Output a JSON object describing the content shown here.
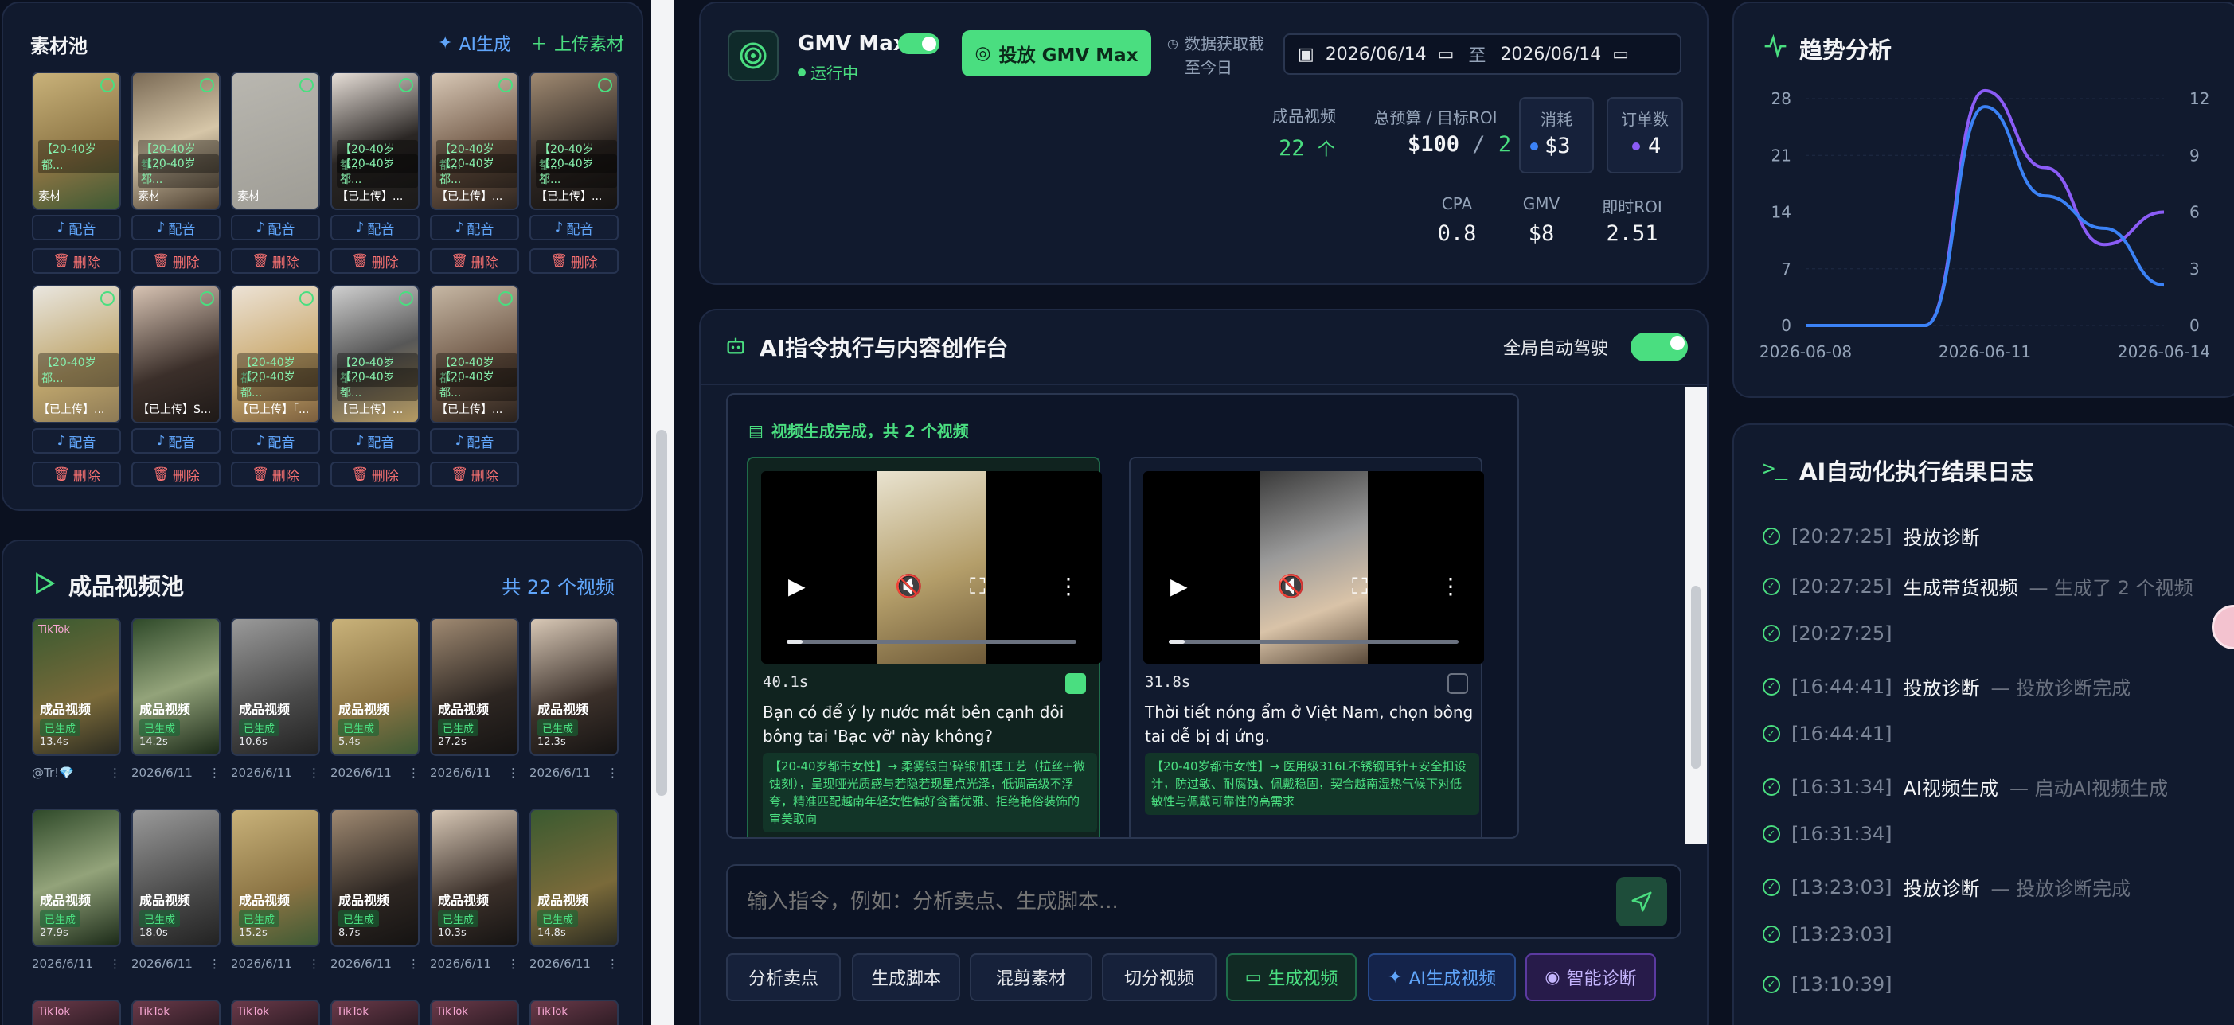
{
  "material_pool": {
    "title": "素材池",
    "ai_generate": "AI生成",
    "upload": "上传素材",
    "dub_label": "配音",
    "delete_label": "删除",
    "items": [
      {
        "tag1": "【20-40岁都...",
        "tag2": "",
        "caption": "素材"
      },
      {
        "tag1": "【20-40岁都...",
        "tag2": "【20-40岁都...",
        "caption": "素材"
      },
      {
        "tag1": "",
        "tag2": "",
        "caption": "素材"
      },
      {
        "tag1": "【20-40岁都...",
        "tag2": "【20-40岁都...",
        "caption": "【已上传】..."
      },
      {
        "tag1": "【20-40岁都...",
        "tag2": "【20-40岁都...",
        "caption": "【已上传】..."
      },
      {
        "tag1": "【20-40岁都...",
        "tag2": "【20-40岁都...",
        "caption": "【已上传】..."
      },
      {
        "tag1": "【20-40岁都...",
        "tag2": "",
        "caption": "【已上传】..."
      },
      {
        "tag1": "",
        "tag2": "",
        "caption": "【已上传】S..."
      },
      {
        "tag1": "【20-40岁都...",
        "tag2": "【20-40岁都...",
        "caption": "【已上传】「..."
      },
      {
        "tag1": "【20-40岁都...",
        "tag2": "【20-40岁都...",
        "caption": "【已上传】..."
      },
      {
        "tag1": "【20-40岁都...",
        "tag2": "【20-40岁都...",
        "caption": "【已上传】..."
      }
    ]
  },
  "video_pool": {
    "title": "成品视频池",
    "count": "共 22 个视频",
    "card_label": "成品视频",
    "generated": "已生成",
    "tiktok": "TikTok",
    "rows": [
      [
        {
          "dur": "13.4s",
          "meta": "@Tr!💎",
          "tiktok": true
        },
        {
          "dur": "14.2s",
          "meta": "2026/6/11",
          "tiktok": false
        },
        {
          "dur": "10.6s",
          "meta": "2026/6/11",
          "tiktok": false
        },
        {
          "dur": "5.4s",
          "meta": "2026/6/11",
          "tiktok": false
        },
        {
          "dur": "27.2s",
          "meta": "2026/6/11",
          "tiktok": false
        },
        {
          "dur": "12.3s",
          "meta": "2026/6/11",
          "tiktok": false
        }
      ],
      [
        {
          "dur": "27.9s",
          "meta": "2026/6/11",
          "tiktok": false
        },
        {
          "dur": "18.0s",
          "meta": "2026/6/11",
          "tiktok": false
        },
        {
          "dur": "15.2s",
          "meta": "2026/6/11",
          "tiktok": false
        },
        {
          "dur": "8.7s",
          "meta": "2026/6/11",
          "tiktok": false
        },
        {
          "dur": "10.3s",
          "meta": "2026/6/11",
          "tiktok": false
        },
        {
          "dur": "14.8s",
          "meta": "2026/6/11",
          "tiktok": false
        }
      ]
    ]
  },
  "gmv": {
    "name": "GMV Max",
    "status": "运行中",
    "launch_button": "投放 GMV Max",
    "fetch_label_1": "数据获取截",
    "fetch_label_2": "至今日",
    "date_from": "2026/06/14",
    "date_sep": "至",
    "date_to": "2026/06/14",
    "finished_videos_label": "成品视频",
    "finished_videos_value": "22",
    "finished_videos_unit": "个",
    "budget_label": "总预算 / 目标ROI",
    "budget_value": "$100",
    "budget_sep": "/",
    "roi_target": "2",
    "spend_label": "消耗",
    "spend_value": "$3",
    "orders_label": "订单数",
    "orders_value": "4",
    "cpa_label": "CPA",
    "cpa_value": "0.8",
    "gmv_label": "GMV",
    "gmv_value": "$8",
    "roi_label": "即时ROI",
    "roi_value": "2.51"
  },
  "ai_workspace": {
    "title": "AI指令执行与内容创作台",
    "auto_pilot": "全局自动驾驶",
    "done_label": "视频生成完成，共 2 个视频",
    "videos": [
      {
        "duration": "40.1s",
        "text": "Bạn có để ý ly nước mát bên cạnh đôi bông tai 'Bạc vỡ' này không?",
        "desc": "【20-40岁都市女性】→ 柔雾银白'碎银'肌理工艺（拉丝+微蚀刻），呈现哑光质感与若隐若现星点光泽，低调高级不浮夸，精准匹配越南年轻女性偏好含蓄优雅、拒绝艳俗装饰的审美取向",
        "selected": true
      },
      {
        "duration": "31.8s",
        "text": "Thời tiết nóng ẩm ở Việt Nam, chọn bông tai dễ bị dị ứng.",
        "desc": "【20-40岁都市女性】→ 医用级316L不锈钢耳针+安全扣设计，防过敏、耐腐蚀、佩戴稳固，契合越南湿热气候下对低敏性与佩戴可靠性的高需求",
        "selected": false
      }
    ],
    "input_placeholder": "输入指令，例如：分析卖点、生成脚本...",
    "chips": [
      "分析卖点",
      "生成脚本",
      "混剪素材",
      "切分视频",
      "生成视频",
      "AI生成视频",
      "智能诊断"
    ]
  },
  "trend": {
    "title": "趋势分析",
    "chart_data": {
      "type": "line",
      "x": [
        "2026-06-08",
        "2026-06-09",
        "2026-06-10",
        "2026-06-11",
        "2026-06-12",
        "2026-06-13",
        "2026-06-14"
      ],
      "x_ticks": [
        "2026-06-08",
        "2026-06-11",
        "2026-06-14"
      ],
      "left_axis": {
        "ticks": [
          0,
          7,
          21,
          14,
          28
        ],
        "range": [
          0,
          28
        ]
      },
      "right_axis": {
        "ticks": [
          0,
          3,
          6,
          9,
          12
        ],
        "range": [
          0,
          12
        ]
      },
      "series": [
        {
          "color": "#8b5cf6",
          "axis": "left",
          "values": [
            0,
            0,
            0,
            29,
            19.5,
            10,
            14
          ]
        },
        {
          "color": "#3b82f6",
          "axis": "left",
          "values": [
            0,
            0,
            0,
            27,
            16,
            12,
            5
          ]
        }
      ]
    }
  },
  "log": {
    "title": "AI自动化执行结果日志",
    "entries": [
      {
        "time": "[20:27:25]",
        "action": "投放诊断",
        "note": ""
      },
      {
        "time": "[20:27:25]",
        "action": "生成带货视频",
        "note": "— 生成了 2 个视频"
      },
      {
        "time": "[20:27:25]",
        "action": "",
        "note": ""
      },
      {
        "time": "[16:44:41]",
        "action": "投放诊断",
        "note": "— 投放诊断完成"
      },
      {
        "time": "[16:44:41]",
        "action": "",
        "note": ""
      },
      {
        "time": "[16:31:34]",
        "action": "AI视频生成",
        "note": "— 启动AI视频生成"
      },
      {
        "time": "[16:31:34]",
        "action": "",
        "note": ""
      },
      {
        "time": "[13:23:03]",
        "action": "投放诊断",
        "note": "— 投放诊断完成"
      },
      {
        "time": "[13:23:03]",
        "action": "",
        "note": ""
      },
      {
        "time": "[13:10:39]",
        "action": "",
        "note": ""
      }
    ]
  },
  "colors": {
    "accent_green": "#4ade80",
    "accent_blue": "#60a5fa",
    "accent_purple": "#8b5cf6",
    "bg": "#0b1120",
    "panel": "#111a2e"
  }
}
